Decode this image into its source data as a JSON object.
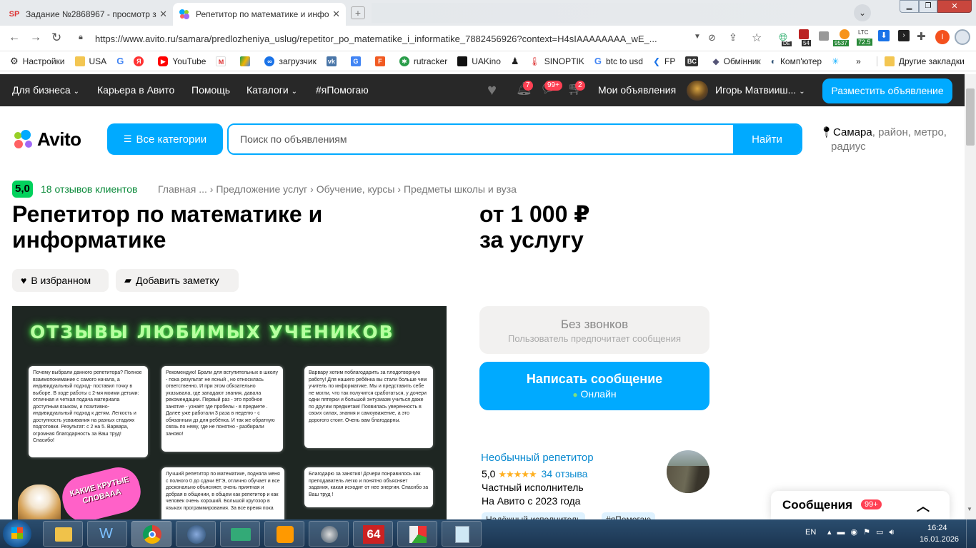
{
  "browser": {
    "tabs": [
      {
        "title": "Задание №2868967 - просмотр за",
        "favicon": "SP",
        "active": false
      },
      {
        "title": "Репетитор по математике и инфо",
        "favicon": "avito-icon",
        "active": true
      }
    ],
    "url": "https://www.avito.ru/samara/predlozheniya_uslug/repetitor_po_matematike_i_informatike_7882456926?context=H4sIAAAAAAAA_wE_...",
    "ext_badges": {
      "de": "DE",
      "n54": "54",
      "btc": "9537",
      "ltc_label": "LTC",
      "ltc": "72.5",
      "profile": "I"
    },
    "bookmarks": [
      "Настройки",
      "USA",
      "",
      "",
      "YouTube",
      "",
      "",
      "загрузчик",
      "",
      "",
      "",
      "rutracker",
      "UAKino",
      "",
      "SINOPTIK",
      "btc to usd",
      "FP",
      "",
      "Обмінник",
      "Комп'ютер",
      "",
      "»",
      "Другие закладки"
    ]
  },
  "header": {
    "nav": [
      "Для бизнеса",
      "Карьера в Авито",
      "Помощь",
      "Каталоги",
      "#яПомогаю"
    ],
    "badges": {
      "notifications": "7",
      "messages": "99+",
      "cart": "2"
    },
    "my_ads": "Мои объявления",
    "user": "Игорь Матвииш...",
    "post_button": "Разместить объявление"
  },
  "search": {
    "logo": "Avito",
    "categories_button": "Все категории",
    "placeholder": "Поиск по объявлениям",
    "find_button": "Найти",
    "location": "Самара",
    "location_extra": ", район, метро,",
    "location_extra2": "радиус"
  },
  "listing": {
    "rating": "5,0",
    "reviews": "18 отзывов клиентов",
    "breadcrumbs": [
      "Главная",
      "...",
      "Предложение услуг",
      "Обучение, курсы",
      "Предметы школы и вуза"
    ],
    "title_line1": "Репетитор по математике и",
    "title_line2": "информатике",
    "price_line1": "от 1 000 ₽",
    "price_line2": "за услугу",
    "favorite_button": "В избранном",
    "note_button": "Добавить заметку"
  },
  "photo": {
    "heading": "ОТЗЫВЫ ЛЮБИМЫХ УЧЕНИКОВ",
    "sticker": "КАКИЕ КРУТЫЕ СЛОВААА",
    "reviews": [
      "Почему выбрали данного репетитора? Полное взаимопонимание с самого начала, а индивидуальный подход- поставил точку в выборе. В ходе работы с 2-мя моими детьми: отличная и четкая подача материала доступным языком, и позитивно-индивидуальный подход к детям. Легкость и доступность усваивания на разных стадиях подготовки. Результат: с 2 на 5. Варвара, огромная благодарность за Ваш труд! Спасибо!",
      "Рекомендую! Брали для вступительных в школу - пока результат не ясный , но относилась ответственно. И при этом обязательно указывала, где западают знания, давала рекомендации. Первый раз - это пробное занятие - узнаёт где пробелы - в предмете . Далее уже работали 3 раза в неделю - с обязанным дз для ребёнка. И так же обратную связь по нему, где не понятно - разбирали заново!",
      "Варвару хотим поблагодарить за плодотворную работу! Для нашего ребёнка вы стали больше чем учитель по информатике. Мы и представить себе не могли, что так получится сработаться, у дочери одни пятерки и большой энтузиазм учиться даже по другим предметам! Появилась уверенность в своих силах, знания и самоуважение, а это дорогого стоит. Очень вам благодарны.",
      "Лучший репетитор по математике, подняла меня с полного 0 до сдачи ЕГЭ, отлично обучает и все досконально объясняет, очень приятная и добрая в общении, в общем как репетитор и как человек очень хороший. Большой кругозор в языках программирования. За все время пока",
      "Благодарю за занятия! Дочери понравилось как преподаватель легко и понятно объясняет задания, какая исходит от нее энергия. Спасибо за Ваш труд !"
    ]
  },
  "contact": {
    "no_calls": "Без звонков",
    "no_calls_sub": "Пользователь предпочитает сообщения",
    "write_button": "Написать сообщение",
    "online": "Онлайн"
  },
  "seller": {
    "name": "Необычный репетитор",
    "rating": "5,0",
    "stars": 5,
    "reviews": "34 отзыва",
    "type": "Частный исполнитель",
    "since": "На Авито с 2023 года",
    "tags": [
      "Надёжный исполнитель",
      "#яПомогаю"
    ]
  },
  "messages_panel": {
    "label": "Сообщения",
    "count": "99+"
  },
  "taskbar": {
    "lang": "EN",
    "time": "16:24",
    "date": "16.01.2026",
    "app64": "64"
  },
  "colors": {
    "accent": "#00aaff",
    "header": "#282828",
    "rating_green": "#02d15c",
    "badge_red": "#ff4053"
  }
}
